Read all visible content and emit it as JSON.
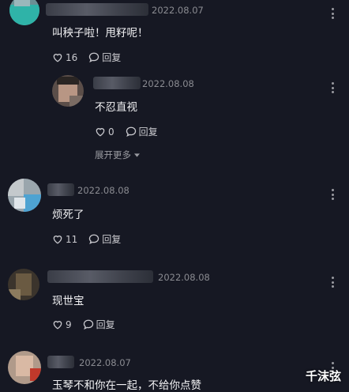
{
  "comments": [
    {
      "date": "2022.08.07",
      "text": "叫秧子啦！甩籽呢！",
      "likes": "16",
      "reply": "回复"
    },
    {
      "date": "2022.08.08",
      "text": "不忍直视",
      "likes": "0",
      "reply": "回复"
    },
    {
      "date": "2022.08.08",
      "text": "烦死了",
      "likes": "11",
      "reply": "回复"
    },
    {
      "date": "2022.08.08",
      "text": "现世宝",
      "likes": "9",
      "reply": "回复"
    },
    {
      "date": "2022.08.07",
      "text": "玉琴不和你在一起，不给你点赞"
    }
  ],
  "expand_label": "展开更多",
  "watermark": "千沫弦",
  "icons": {
    "like": "heart-icon",
    "reply": "comment-bubble-icon",
    "more": "more-vertical-icon",
    "expand": "caret-down-icon"
  },
  "colors": {
    "background": "#161823",
    "text": "#f2f2f4",
    "muted": "#8a8b91"
  }
}
